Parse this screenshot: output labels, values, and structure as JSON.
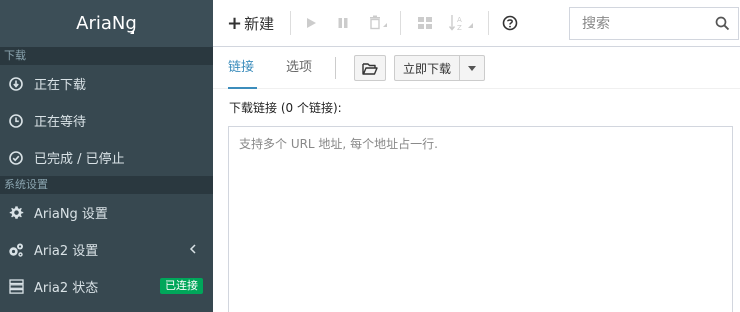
{
  "sidebar": {
    "brand": "AriaNg",
    "sections": [
      {
        "title": "下载"
      },
      {
        "title": "系统设置"
      }
    ],
    "items": [
      {
        "label": "正在下载",
        "icon": "download-circle-icon"
      },
      {
        "label": "正在等待",
        "icon": "clock-icon"
      },
      {
        "label": "已完成 / 已停止",
        "icon": "check-circle-icon"
      },
      {
        "label": "AriaNg 设置",
        "icon": "gear-icon"
      },
      {
        "label": "Aria2 设置",
        "icon": "gears-icon"
      },
      {
        "label": "Aria2 状态",
        "icon": "server-icon",
        "badge": "已连接",
        "badge_color": "#00a65a"
      }
    ]
  },
  "toolbar": {
    "new_label": "新建",
    "search": {
      "placeholder": "搜索"
    }
  },
  "tabs": [
    {
      "label": "链接",
      "active": true
    },
    {
      "label": "选项",
      "active": false
    }
  ],
  "actions": {
    "download_now_label": "立即下载"
  },
  "main": {
    "links_label": "下载链接 (0 个链接):",
    "url_placeholder": "支持多个 URL 地址, 每个地址占一行."
  },
  "colors": {
    "sidebar_bg": "#374850",
    "brand_bg": "#3c4e57",
    "accent": "#3c8dbc",
    "badge_green": "#00a65a"
  }
}
